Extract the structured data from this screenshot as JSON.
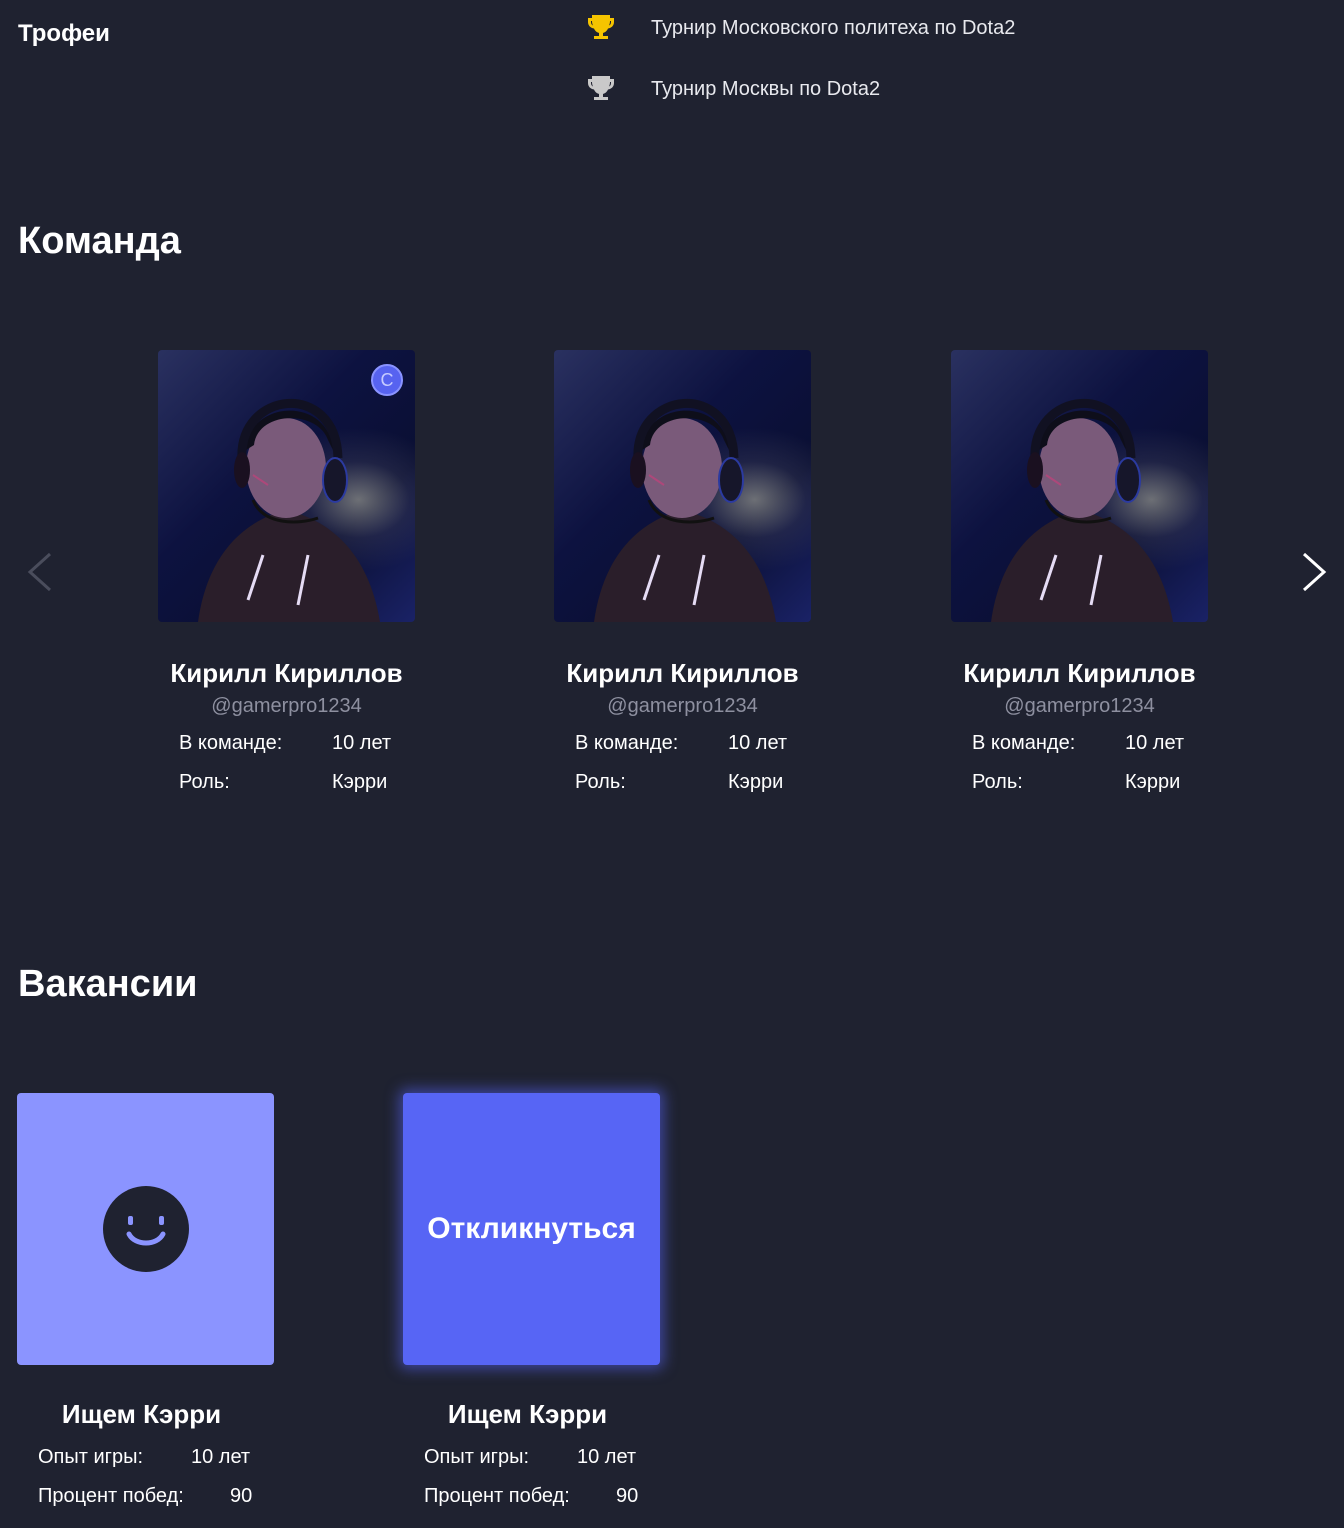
{
  "trophies": {
    "title": "Трофеи",
    "items": [
      {
        "label": "Турнир Московского политеха по Dota2",
        "icon": "trophy-gold-icon",
        "color": "#f5c400"
      },
      {
        "label": "Турнир Москвы по Dota2",
        "icon": "trophy-silver-icon",
        "color": "#c9c9c9"
      }
    ]
  },
  "team": {
    "title": "Команда",
    "members": [
      {
        "name": "Кирилл Кириллов",
        "handle": "@gamerpro1234",
        "in_team_label": "В команде:",
        "in_team_value": "10 лет",
        "role_label": "Роль:",
        "role_value": "Кэрри",
        "badge": "C"
      },
      {
        "name": "Кирилл Кириллов",
        "handle": "@gamerpro1234",
        "in_team_label": "В команде:",
        "in_team_value": "10 лет",
        "role_label": "Роль:",
        "role_value": "Кэрри"
      },
      {
        "name": "Кирилл Кириллов",
        "handle": "@gamerpro1234",
        "in_team_label": "В команде:",
        "in_team_value": "10 лет",
        "role_label": "Роль:",
        "role_value": "Кэрри"
      }
    ]
  },
  "vacancies": {
    "title": "Вакансии",
    "items": [
      {
        "title": "Ищем Кэрри",
        "exp_label": "Опыт игры:",
        "exp_value": "10 лет",
        "wins_label": "Процент побед:",
        "wins_value": "90"
      },
      {
        "title": "Ищем Кэрри",
        "exp_label": "Опыт игры:",
        "exp_value": "10 лет",
        "wins_label": "Процент побед:",
        "wins_value": "90",
        "button_label": "Откликнуться"
      }
    ]
  },
  "colors": {
    "background": "#1f2230",
    "accent": "#5765f5",
    "accent_light": "#8b94ff",
    "muted_text": "#8e90a0"
  }
}
